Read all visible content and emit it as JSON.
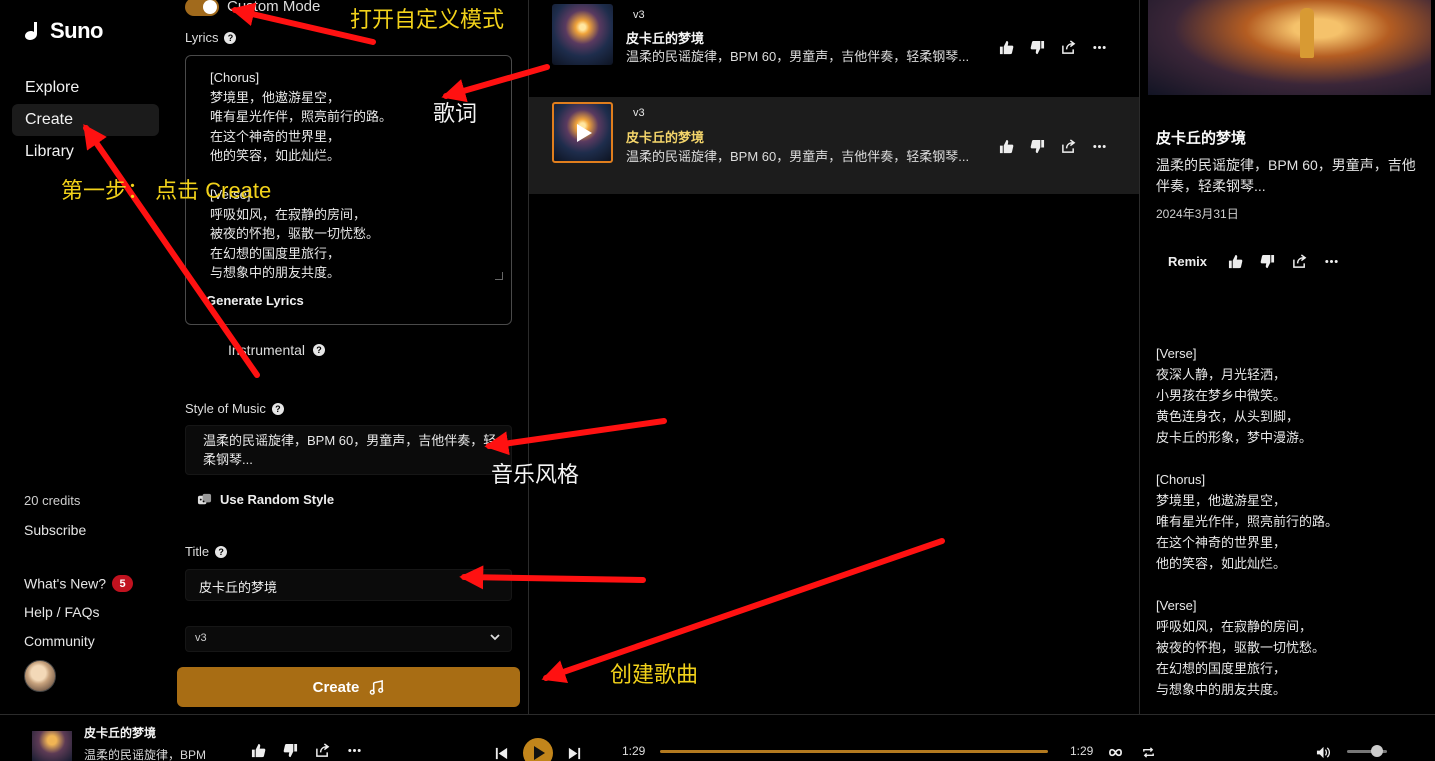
{
  "app": {
    "name": "Suno"
  },
  "sidebar": {
    "nav": [
      {
        "label": "Explore"
      },
      {
        "label": "Create"
      },
      {
        "label": "Library"
      }
    ],
    "credits": "20 credits",
    "subscribe": "Subscribe",
    "whats_new": "What's New?",
    "whats_new_count": "5",
    "help": "Help / FAQs",
    "community": "Community"
  },
  "create_form": {
    "custom_mode_label": "Custom Mode",
    "lyrics_label": "Lyrics",
    "lyrics_text": "[Chorus]\n梦境里，他遨游星空，\n唯有星光作伴，照亮前行的路。\n在这个神奇的世界里，\n他的笑容，如此灿烂。\n\n[Verse]\n呼吸如风，在寂静的房间，\n被夜的怀抱，驱散一切忧愁。\n在幻想的国度里旅行，\n与想象中的朋友共度。",
    "generate_lyrics": "Generate Lyrics",
    "instrumental_label": "Instrumental",
    "style_label": "Style of Music",
    "style_value": "温柔的民谣旋律，BPM 60，男童声，吉他伴奏，轻柔钢琴...",
    "random_style": "Use Random Style",
    "title_label": "Title",
    "title_value": "皮卡丘的梦境",
    "model_value": "v3",
    "create_button": "Create"
  },
  "songs": [
    {
      "version": "v3",
      "title": "皮卡丘的梦境",
      "description": "温柔的民谣旋律，BPM 60，男童声，吉他伴奏，轻柔钢琴..."
    },
    {
      "version": "v3",
      "title": "皮卡丘的梦境",
      "description": "温柔的民谣旋律，BPM 60，男童声，吉他伴奏，轻柔钢琴..."
    }
  ],
  "detail": {
    "title": "皮卡丘的梦境",
    "description": "温柔的民谣旋律，BPM 60，男童声，吉他伴奏，轻柔钢琴...",
    "date": "2024年3月31日",
    "remix": "Remix",
    "lyrics": "[Verse]\n夜深人静，月光轻洒，\n小男孩在梦乡中微笑。\n黄色连身衣，从头到脚，\n皮卡丘的形象，梦中漫游。\n\n[Chorus]\n梦境里，他遨游星空，\n唯有星光作伴，照亮前行的路。\n在这个神奇的世界里，\n他的笑容，如此灿烂。\n\n[Verse]\n呼吸如风，在寂静的房间，\n被夜的怀抱，驱散一切忧愁。\n在幻想的国度里旅行，\n与想象中的朋友共度。"
  },
  "player": {
    "title": "皮卡丘的梦境",
    "subtitle": "温柔的民谣旋律，BPM",
    "current_time": "1:29",
    "duration": "1:29",
    "progress": 1.0,
    "volume": 0.75
  },
  "annotations": {
    "custom_mode": "打开自定义模式",
    "lyrics": "歌词",
    "step_one": "第一步：  点击 Create",
    "style": "音乐风格",
    "create_song": "创建歌曲"
  },
  "colors": {
    "accent": "#a86d14",
    "highlight_title": "#f3d46a",
    "annotation_yellow": "#f2d21a",
    "arrow_red": "#ff1111"
  }
}
